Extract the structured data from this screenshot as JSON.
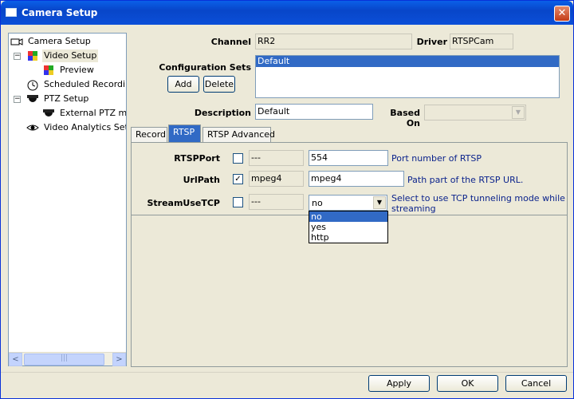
{
  "window": {
    "title": "Camera Setup",
    "close_glyph": "✕"
  },
  "tree": {
    "items": [
      {
        "label": "Camera Setup",
        "icon": "camera-icon"
      },
      {
        "label": "Video Setup",
        "icon": "video-setup-icon"
      },
      {
        "label": "Preview",
        "icon": "preview-icon"
      },
      {
        "label": "Scheduled Recording S",
        "icon": "clock-icon"
      },
      {
        "label": "PTZ Setup",
        "icon": "ptz-dome-icon"
      },
      {
        "label": "External PTZ mod",
        "icon": "ptz-dome-icon"
      },
      {
        "label": "Video Analytics Setup",
        "icon": "eye-icon"
      }
    ],
    "expander_collapse": "−",
    "scroll_left": "<",
    "scroll_right": ">",
    "scroll_thumb_grip": "|||"
  },
  "channel": {
    "label": "Channel",
    "value": "RR2"
  },
  "driver": {
    "label": "Driver",
    "value": "RTSPCam"
  },
  "config_sets": {
    "label": "Configuration Sets",
    "add_label": "Add",
    "delete_label": "Delete",
    "items": [
      "Default"
    ]
  },
  "description": {
    "label": "Description",
    "value": "Default"
  },
  "based_on": {
    "label": "Based On",
    "value": ""
  },
  "tabs": [
    {
      "label": "Record"
    },
    {
      "label": "RTSP"
    },
    {
      "label": "RTSP Advanced"
    }
  ],
  "rtsp": {
    "rows": [
      {
        "label": "RTSPPort",
        "checked": "",
        "default": "---",
        "value": "554",
        "help": "Port number of RTSP"
      },
      {
        "label": "UrlPath",
        "checked": "✓",
        "default": "mpeg4",
        "value": "mpeg4",
        "help": "Path part of the RTSP URL."
      },
      {
        "label": "StreamUseTCP",
        "checked": "",
        "default": "---",
        "value": "no",
        "help": "Select to use TCP tunneling mode while",
        "help2": "streaming"
      }
    ],
    "dropdown_options": [
      "no",
      "yes",
      "http"
    ]
  },
  "footer": {
    "apply_label": "Apply",
    "ok_label": "OK",
    "cancel_label": "Cancel"
  },
  "colors": {
    "selection": "#316ac5",
    "help_text": "#0b238c",
    "titlebar": "#0846c9"
  }
}
